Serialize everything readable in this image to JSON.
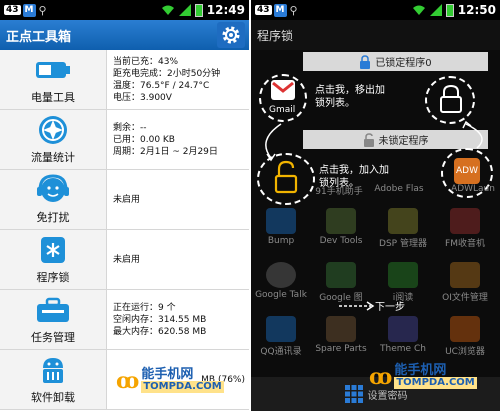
{
  "left_phone": {
    "status": {
      "badge": "43",
      "m": "M",
      "time": "12:49"
    },
    "title": "正点工具箱",
    "rows": [
      {
        "label": "电量工具",
        "icon": "battery-icon",
        "info": [
          "当前已充：43%",
          "距充电完成：2小时50分钟",
          "温度：76.5°F / 24.7°C",
          "电压：3.900V"
        ]
      },
      {
        "label": "流量统计",
        "icon": "aperture-icon",
        "info": [
          "剩余：--",
          "已用：0.00 KB",
          "周期：2月1日 ~ 2月29日"
        ]
      },
      {
        "label": "免打扰",
        "icon": "headset-face-icon",
        "info": [
          "未启用"
        ]
      },
      {
        "label": "程序锁",
        "icon": "asterisk-lock-icon",
        "info": [
          "未启用"
        ]
      },
      {
        "label": "任务管理",
        "icon": "toolbox-icon",
        "info": [
          "正在运行：9 个",
          "空闲内存：314.55 MB",
          "最大内存：620.58 MB"
        ]
      },
      {
        "label": "软件卸载",
        "icon": "android-icon",
        "info": [
          "MB (76%)"
        ]
      }
    ]
  },
  "right_phone": {
    "status": {
      "badge": "43",
      "m": "M",
      "time": "12:50"
    },
    "title": "程序锁",
    "locked_bar": "已锁定程序0",
    "unlocked_bar": "未锁定程序",
    "tip1": [
      "点击我，移出加",
      "锁列表。"
    ],
    "tip2": [
      "点击我，加入加",
      "锁列表。"
    ],
    "gmail_label": "Gmail",
    "next_label": "下一步",
    "set_password": "设置密码",
    "apps": [
      {
        "label": "91手机助手"
      },
      {
        "label": "Adobe Flas"
      },
      {
        "label": "ADWLaun"
      },
      {
        "label": "Bump"
      },
      {
        "label": "Dev Tools"
      },
      {
        "label": "DSP 管理器"
      },
      {
        "label": "FM收音机"
      },
      {
        "label": "Google Talk"
      },
      {
        "label": "Google 图"
      },
      {
        "label": "i阅读"
      },
      {
        "label": "OI文件管理"
      },
      {
        "label": "QQ通讯录"
      },
      {
        "label": "Spare Parts"
      },
      {
        "label": "Theme Ch"
      },
      {
        "label": "UC浏览器"
      }
    ]
  },
  "watermark": {
    "cn": "能手机网",
    "url": "TOMPDA.COM"
  }
}
